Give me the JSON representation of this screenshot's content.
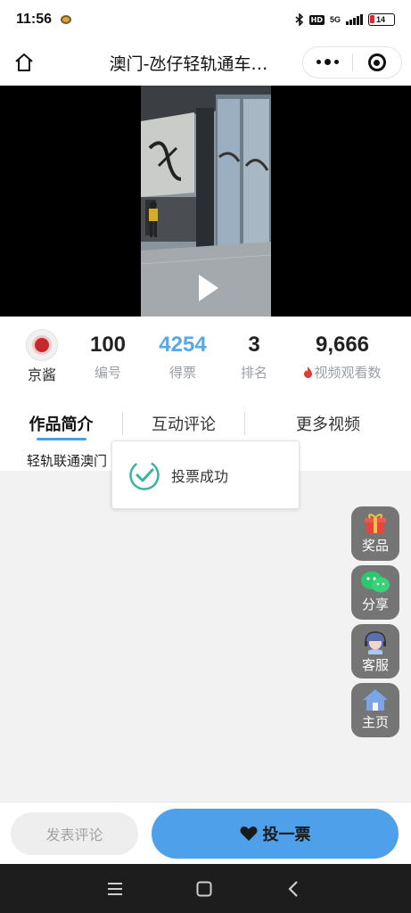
{
  "status_bar": {
    "time": "11:56",
    "network": "5G",
    "battery": "14"
  },
  "nav": {
    "title": "澳门-氹仔轻轨通车…"
  },
  "author": {
    "name": "京酱"
  },
  "stats": [
    {
      "value": "100",
      "label": "编号"
    },
    {
      "value": "4254",
      "label": "得票"
    },
    {
      "value": "3",
      "label": "排名"
    },
    {
      "value": "9,666",
      "label": "视频观看数"
    }
  ],
  "tabs": [
    {
      "label": "作品简介",
      "active": true
    },
    {
      "label": "互动评论",
      "active": false
    },
    {
      "label": "更多视频",
      "active": false
    }
  ],
  "intro": {
    "text": "轻轨联通澳门"
  },
  "toast": {
    "message": "投票成功"
  },
  "float_buttons": [
    {
      "label": "奖品",
      "icon": "gift-icon"
    },
    {
      "label": "分享",
      "icon": "wechat-icon"
    },
    {
      "label": "客服",
      "icon": "customer-service-icon"
    },
    {
      "label": "主页",
      "icon": "home-icon"
    }
  ],
  "bottom_bar": {
    "comment_label": "发表评论",
    "vote_label": "投一票"
  },
  "colors": {
    "accent": "#4ea0ea",
    "votes_value": "#56a8e8",
    "toast_check": "#3bb3a3"
  }
}
